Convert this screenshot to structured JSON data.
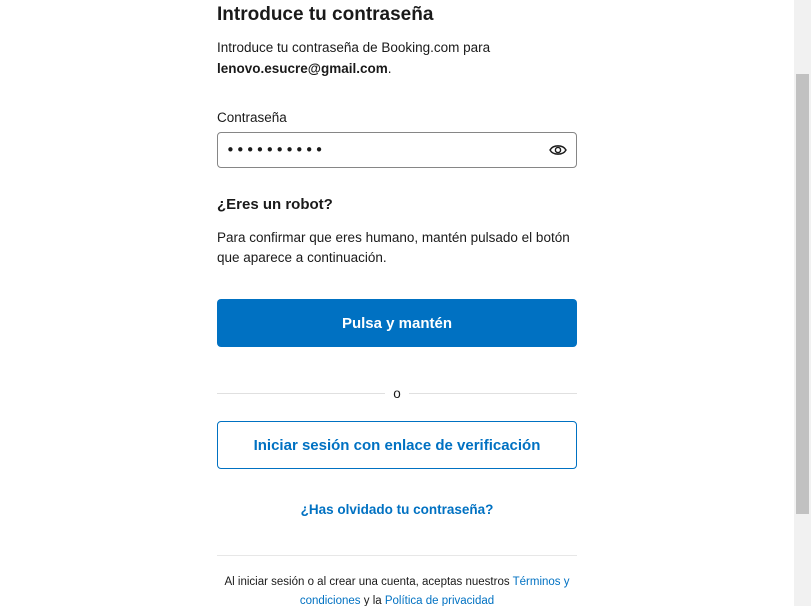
{
  "header": {
    "title": "Introduce tu contraseña",
    "intro_prefix": "Introduce tu contraseña de Booking.com para",
    "email": "lenovo.esucre@gmail.com",
    "intro_suffix": "."
  },
  "password_field": {
    "label": "Contraseña",
    "value": "••••••••••",
    "toggle_icon": "eye-icon"
  },
  "robot_check": {
    "heading": "¿Eres un robot?",
    "text": "Para confirmar que eres humano, mantén pulsado el botón que aparece a continuación.",
    "button_label": "Pulsa y mantén"
  },
  "divider": {
    "label": "o"
  },
  "verification": {
    "button_label": "Iniciar sesión con enlace de verificación"
  },
  "forgot": {
    "link_label": "¿Has olvidado tu contraseña?"
  },
  "legal": {
    "prefix": "Al iniciar sesión o al crear una cuenta, aceptas nuestros",
    "terms_label": "Términos y condiciones",
    "conjunction": "y la",
    "privacy_label": "Política de privacidad"
  },
  "colors": {
    "primary": "#0071c2",
    "text": "#1a1a1a",
    "border": "#868686"
  }
}
